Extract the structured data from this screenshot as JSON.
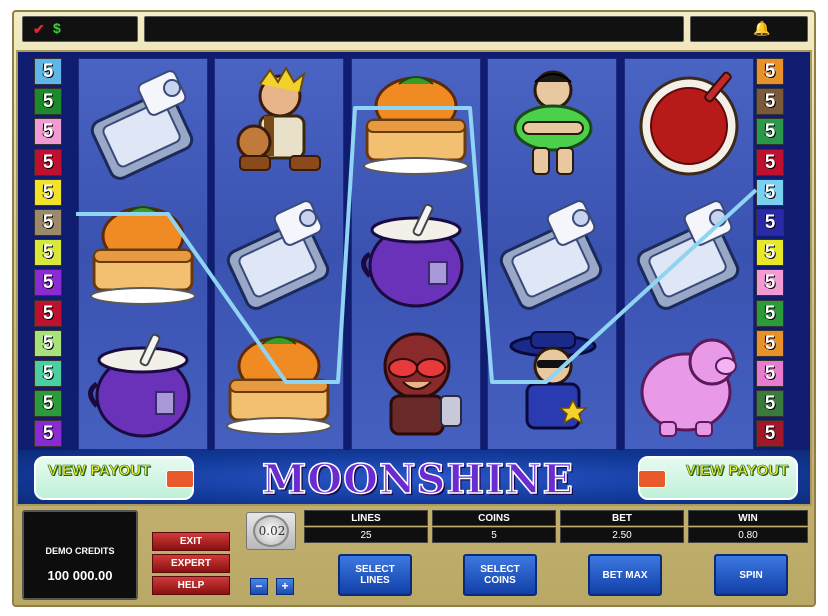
{
  "game": {
    "title": "MOONSHINE",
    "view_payout_left": "VIEW PAYOUT",
    "view_payout_right": "VIEW PAYOUT",
    "left_lines": [
      "5",
      "5",
      "5",
      "5",
      "5",
      "5",
      "5",
      "5",
      "5",
      "5",
      "5",
      "5",
      "5"
    ],
    "right_lines": [
      "5",
      "5",
      "5",
      "5",
      "5",
      "5",
      "5",
      "5",
      "5",
      "5",
      "5",
      "5",
      "5"
    ],
    "left_colors": [
      "#5fb6e8",
      "#1a8a2a",
      "#f29ad4",
      "#c01030",
      "#f2e22a",
      "#9a8a6a",
      "#d8e83a",
      "#8a2ad2",
      "#c01030",
      "#a8e27a",
      "#4ad0a0",
      "#2a9a3a",
      "#8a2ad2"
    ],
    "right_colors": [
      "#e8902a",
      "#7a5a3a",
      "#2a9a4a",
      "#c01030",
      "#7ad0f0",
      "#2a2aa8",
      "#e8e82a",
      "#f29ad4",
      "#2a9a3a",
      "#e8902a",
      "#e87ad0",
      "#3a7a3a",
      "#a01828"
    ],
    "reels": [
      [
        "sardines-can-symbol",
        "pumpkin-pie-symbol",
        "cauldron-symbol"
      ],
      [
        "hillbilly-banjo-symbol",
        "sardines-can-symbol",
        "pumpkin-pie-symbol"
      ],
      [
        "pumpkin-pie-symbol",
        "cauldron-symbol",
        "moonshiner-symbol"
      ],
      [
        "hillbilly-woman-symbol",
        "sardines-can-symbol",
        "sheriff-symbol"
      ],
      [
        "beans-bowl-symbol",
        "sardines-can-symbol",
        "pig-symbol"
      ]
    ],
    "payline_color": "#8fd4f2"
  },
  "controls": {
    "credits_label": "DEMO CREDITS",
    "credits_value": "100 000.00",
    "exit_label": "EXIT",
    "expert_label": "EXPERT",
    "help_label": "HELP",
    "coin_value": "0.02",
    "minus_label": "−",
    "plus_label": "+",
    "lines_label": "LINES",
    "lines_value": "25",
    "coins_label": "COINS",
    "coins_value": "5",
    "bet_label": "BET",
    "bet_value": "2.50",
    "win_label": "WIN",
    "win_value": "0.80",
    "select_lines_label": "SELECT LINES",
    "select_coins_label": "SELECT COINS",
    "bet_max_label": "BET MAX",
    "spin_label": "SPIN"
  },
  "topbar": {
    "icons": [
      "check-icon",
      "dollar-icon",
      "bell-icon"
    ]
  }
}
